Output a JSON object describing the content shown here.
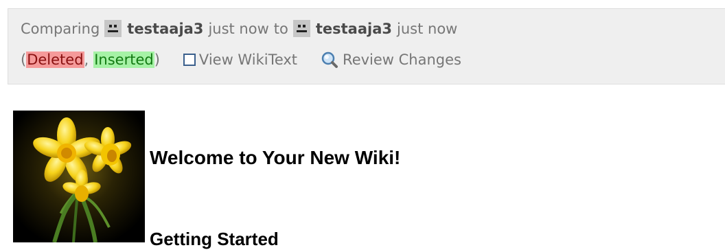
{
  "compare": {
    "comparing_label": "Comparing",
    "user_left": "testaaja3",
    "time_left": "just now",
    "to_label": "to",
    "user_right": "testaaja3",
    "time_right": "just now"
  },
  "legend": {
    "open_paren": "(",
    "deleted": "Deleted",
    "comma": ",",
    "inserted": "Inserted",
    "close_paren": ")"
  },
  "actions": {
    "view_wikitext": "View WikiText",
    "review_changes": "Review Changes"
  },
  "content": {
    "image_icon": "daffodil-image",
    "heading_welcome": "Welcome to Your New Wiki!",
    "heading_getting_started": "Getting Started"
  },
  "colors": {
    "deleted_bg": "#f59a9a",
    "inserted_bg": "#a6f2a6",
    "bar_bg": "#efefef"
  }
}
